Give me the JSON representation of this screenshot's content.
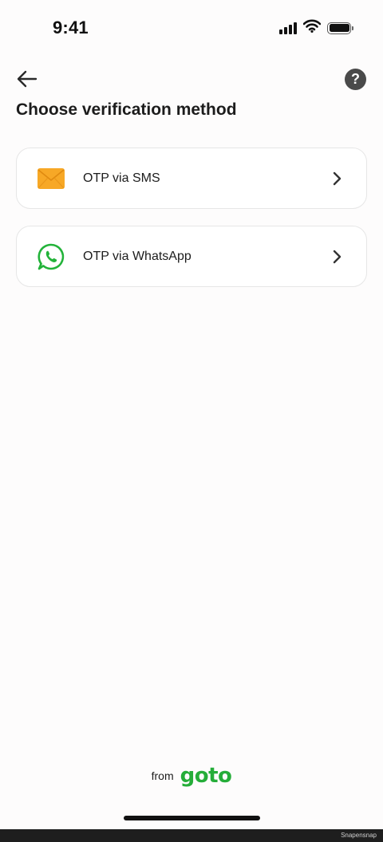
{
  "status_bar": {
    "time": "9:41",
    "icons": [
      "signal-icon",
      "wifi-icon",
      "battery-icon"
    ]
  },
  "header": {
    "back_icon": "arrow-left-icon",
    "help_label": "?",
    "title": "Choose verification method"
  },
  "options": [
    {
      "label": "OTP via SMS",
      "icon": "envelope-icon",
      "icon_color": "#f7a826"
    },
    {
      "label": "OTP via WhatsApp",
      "icon": "whatsapp-icon",
      "icon_color": "#23b33a"
    }
  ],
  "footer": {
    "from_text": "from",
    "brand": "goto",
    "brand_color": "#25ad39"
  },
  "watermark": "Snapensnap"
}
